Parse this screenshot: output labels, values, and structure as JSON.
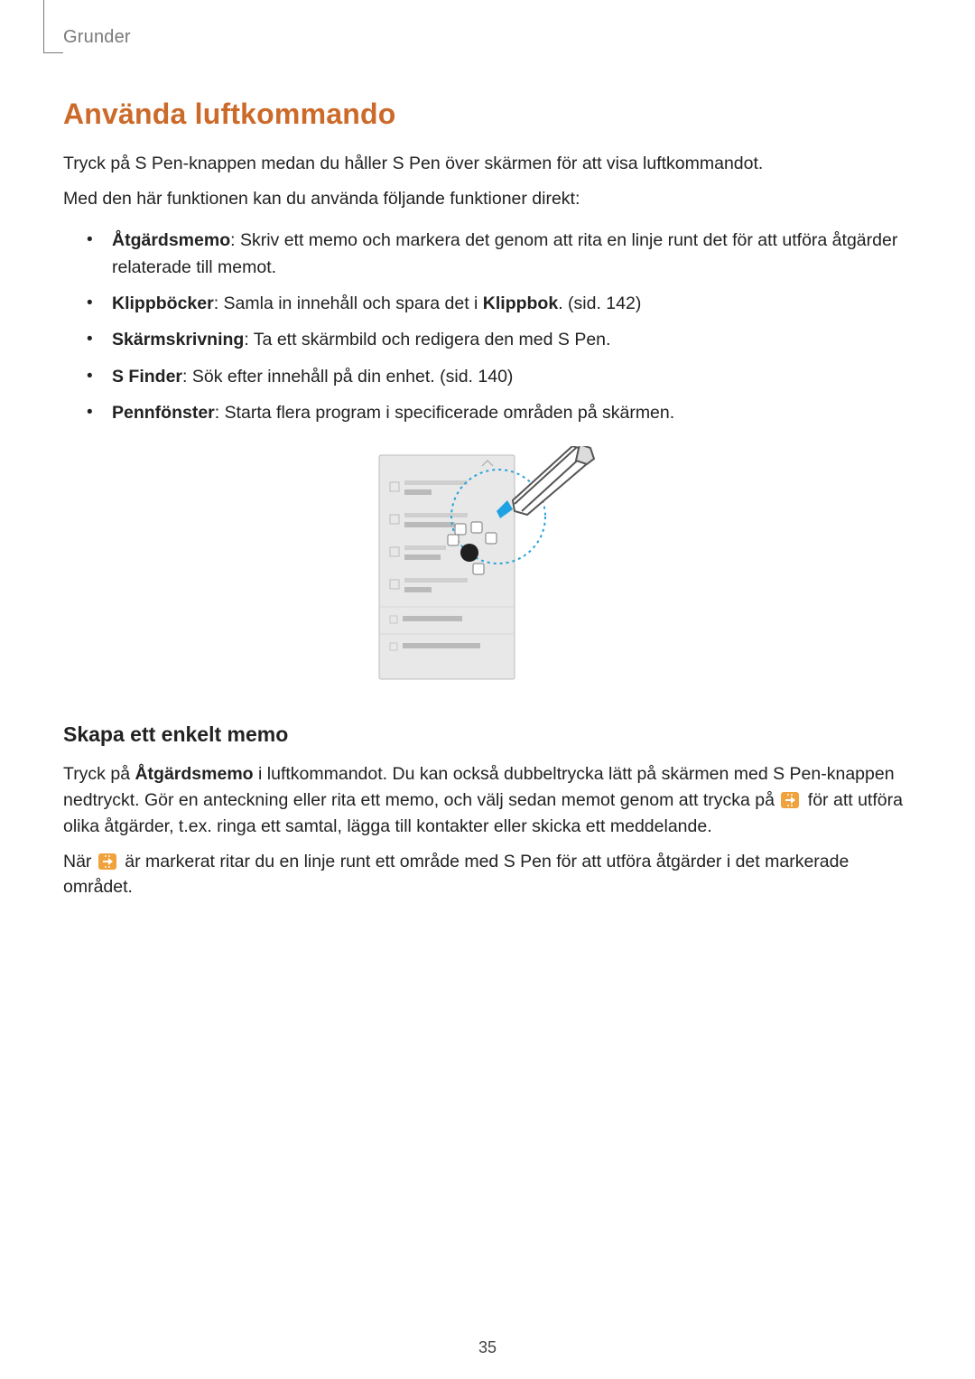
{
  "header": {
    "section": "Grunder"
  },
  "title": "Använda luftkommando",
  "intro_p1": "Tryck på S Pen-knappen medan du håller S Pen över skärmen för att visa luftkommandot.",
  "intro_p2": "Med den här funktionen kan du använda följande funktioner direkt:",
  "bullets": {
    "b1_term": "Åtgärdsmemo",
    "b1_desc": ": Skriv ett memo och markera det genom att rita en linje runt det för att utföra åtgärder relaterade till memot.",
    "b2_term": "Klippböcker",
    "b2_desc_a": ": Samla in innehåll och spara det i ",
    "b2_desc_bold": "Klippbok",
    "b2_desc_b": ". (sid. 142)",
    "b3_term": "Skärmskrivning",
    "b3_desc": ": Ta ett skärmbild och redigera den med S Pen.",
    "b4_term": "S Finder",
    "b4_desc": ": Sök efter innehåll på din enhet. (sid. 140)",
    "b5_term": "Pennfönster",
    "b5_desc": ": Starta flera program i specificerade områden på skärmen."
  },
  "subheading": "Skapa ett enkelt memo",
  "memo_p1_a": "Tryck på ",
  "memo_p1_bold": "Åtgärdsmemo",
  "memo_p1_b": " i luftkommandot. Du kan också dubbeltrycka lätt på skärmen med S Pen-knappen nedtryckt. Gör en anteckning eller rita ett memo, och välj sedan memot genom att trycka på ",
  "memo_p1_c": " för att utföra olika åtgärder, t.ex. ringa ett samtal, lägga till kontakter eller skicka ett meddelande.",
  "memo_p2_a": "När ",
  "memo_p2_b": " är markerat ritar du en linje runt ett område med S Pen för att utföra åtgärder i det markerade området.",
  "page_number": "35"
}
